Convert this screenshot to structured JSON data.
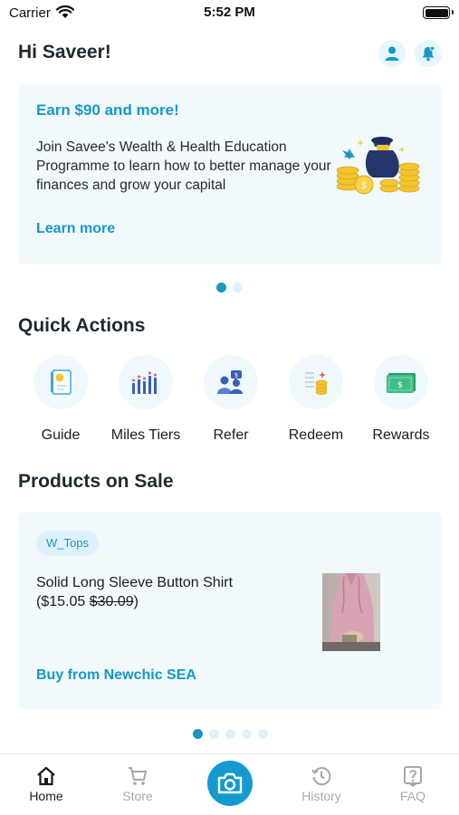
{
  "status_bar": {
    "carrier": "Carrier",
    "time": "5:52 PM"
  },
  "header": {
    "greeting": "Hi Saveer!",
    "profile_icon": "user-icon",
    "notification_icon": "bell-icon"
  },
  "promo": {
    "title": "Earn $90 and more!",
    "body": "Join Savee's Wealth & Health Education Programme to learn how to better manage your finances and grow your capital",
    "link": "Learn more",
    "carousel_index": 1,
    "carousel_count": 2
  },
  "quick_actions": {
    "title": "Quick Actions",
    "items": [
      {
        "label": "Guide",
        "icon": "guide-book-icon"
      },
      {
        "label": "Miles Tiers",
        "icon": "bar-chart-icon"
      },
      {
        "label": "Refer",
        "icon": "people-icon"
      },
      {
        "label": "Redeem",
        "icon": "coins-icon"
      },
      {
        "label": "Rewards",
        "icon": "cash-icon"
      }
    ]
  },
  "products": {
    "title": "Products on Sale",
    "tag": "W_Tops",
    "name": "Solid Long Sleeve Button Shirt",
    "price_open": "($15.05 ",
    "original_price": "$30.09",
    "price_close": ")",
    "buy_link": "Buy from Newchic SEA",
    "carousel_index": 1,
    "carousel_count": 5
  },
  "tab_bar": {
    "tabs": [
      {
        "label": "Home",
        "icon": "home-icon",
        "active": true
      },
      {
        "label": "Store",
        "icon": "cart-icon",
        "active": false
      },
      {
        "label": "History",
        "icon": "history-icon",
        "active": false
      },
      {
        "label": "FAQ",
        "icon": "question-icon",
        "active": false
      }
    ],
    "center_icon": "camera-icon"
  },
  "colors": {
    "accent": "#1698c9",
    "card_bg": "#f1f9fd",
    "title_text": "#1d2a33"
  }
}
